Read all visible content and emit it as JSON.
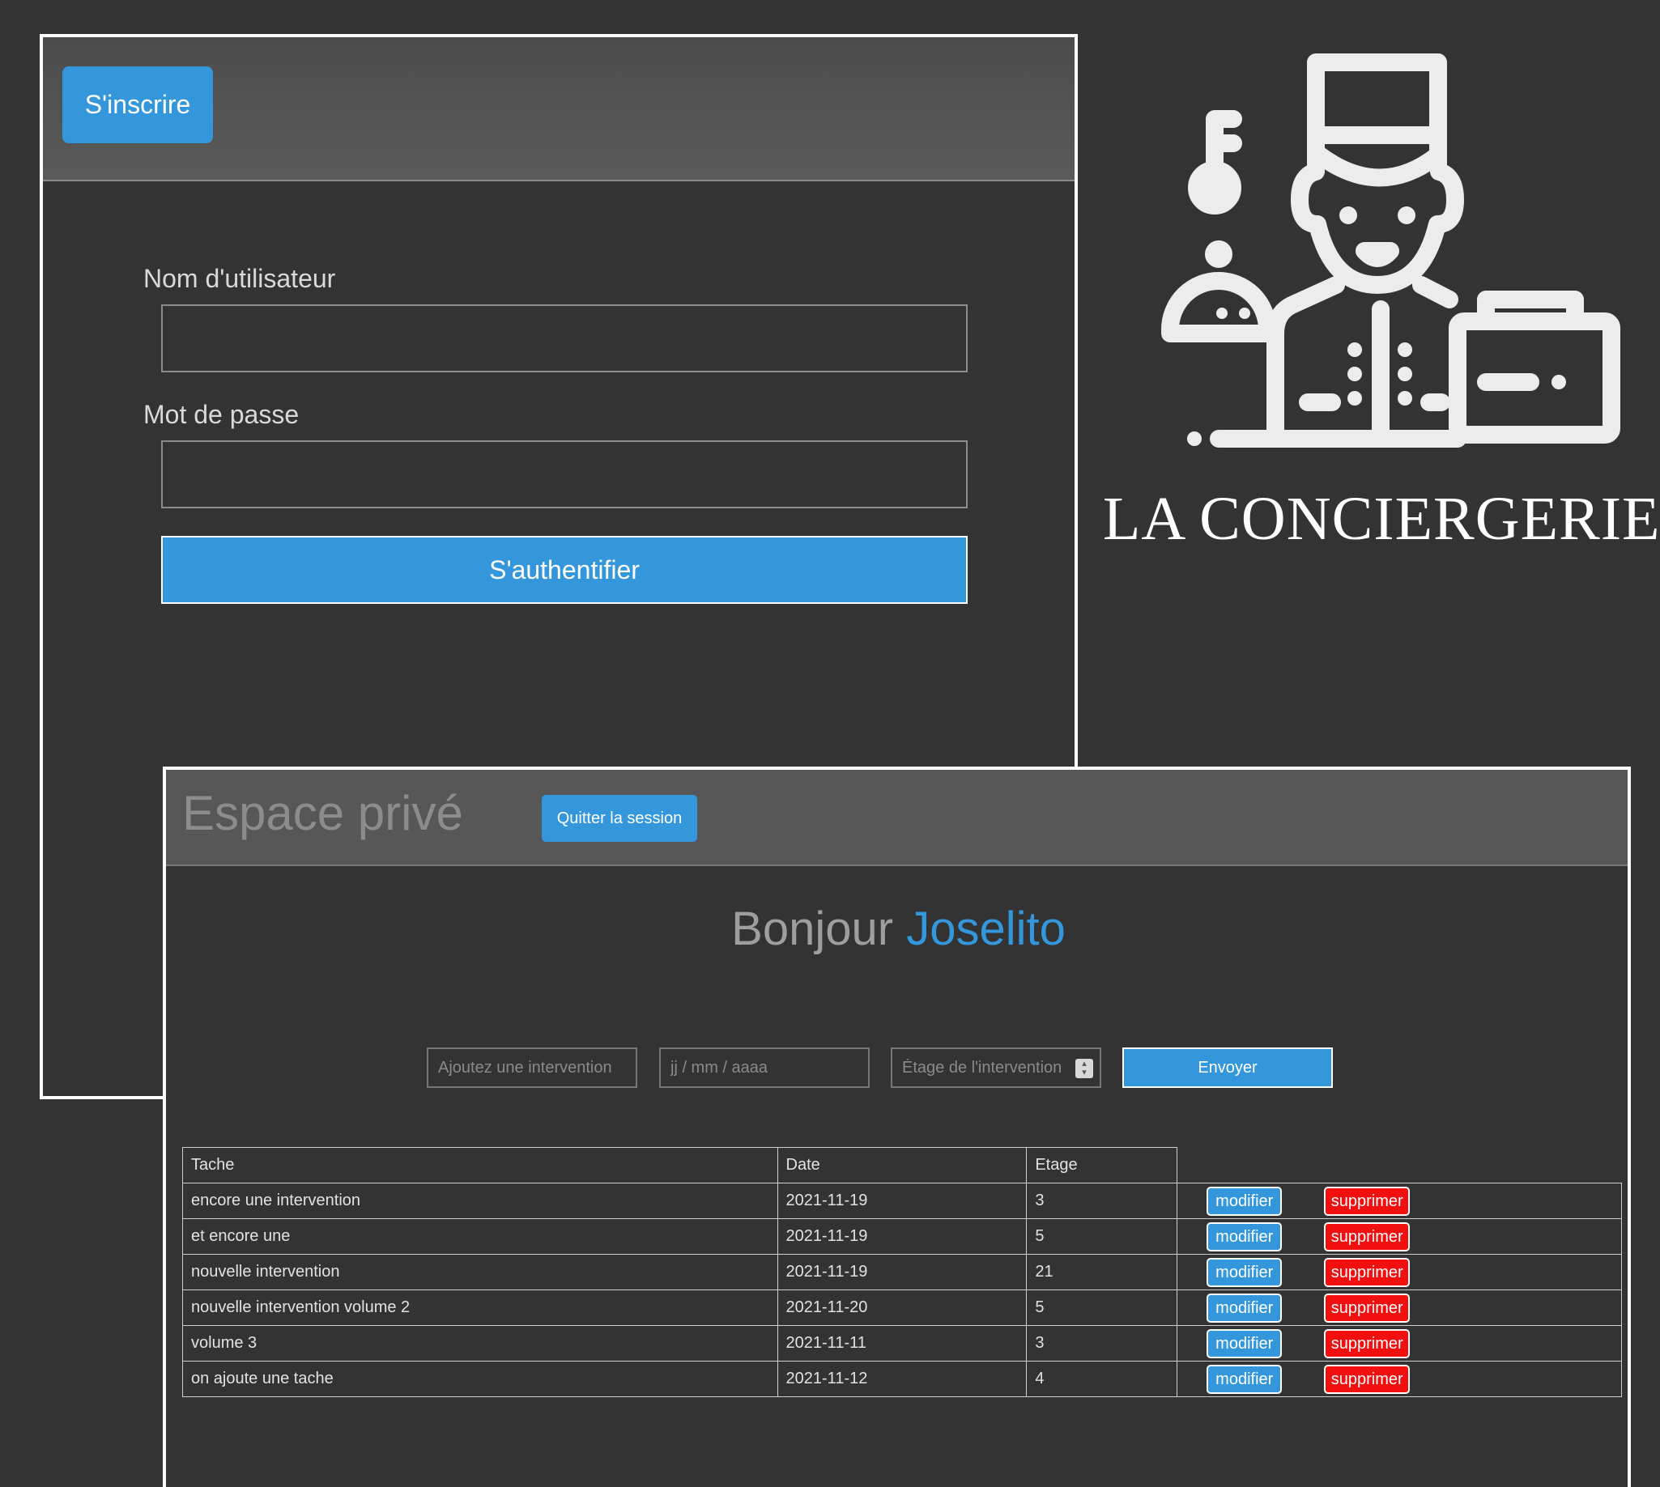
{
  "login": {
    "signup_label": "S'inscrire",
    "username_label": "Nom d'utilisateur",
    "username_value": "",
    "password_label": "Mot de passe",
    "password_value": "",
    "submit_label": "S'authentifier"
  },
  "brand": {
    "name": "LA CONCIERGERIE",
    "logo_icon": "concierge-icon"
  },
  "private_space": {
    "title": "Espace privé",
    "quit_label": "Quitter la session",
    "greeting_prefix": "Bonjour",
    "user_name": "Joselito",
    "form": {
      "intervention_placeholder": "Ajoutez une intervention",
      "date_placeholder": "jj / mm / aaaa",
      "floor_placeholder": "Étage de l'intervention",
      "send_label": "Envoyer"
    },
    "table": {
      "headers": [
        "Tache",
        "Date",
        "Etage"
      ],
      "edit_label": "modifier",
      "delete_label": "supprimer",
      "rows": [
        {
          "task": "encore une intervention",
          "date": "2021-11-19",
          "floor": "3"
        },
        {
          "task": "et encore une",
          "date": "2021-11-19",
          "floor": "5"
        },
        {
          "task": "nouvelle intervention",
          "date": "2021-11-19",
          "floor": "21"
        },
        {
          "task": "nouvelle intervention volume 2",
          "date": "2021-11-20",
          "floor": "5"
        },
        {
          "task": "volume 3",
          "date": "2021-11-11",
          "floor": "3"
        },
        {
          "task": "on ajoute une tache",
          "date": "2021-11-12",
          "floor": "4"
        }
      ]
    }
  },
  "colors": {
    "background": "#333333",
    "accent_blue": "#3497dc",
    "danger_red": "#f10f0f",
    "header_gray": "#575757"
  }
}
